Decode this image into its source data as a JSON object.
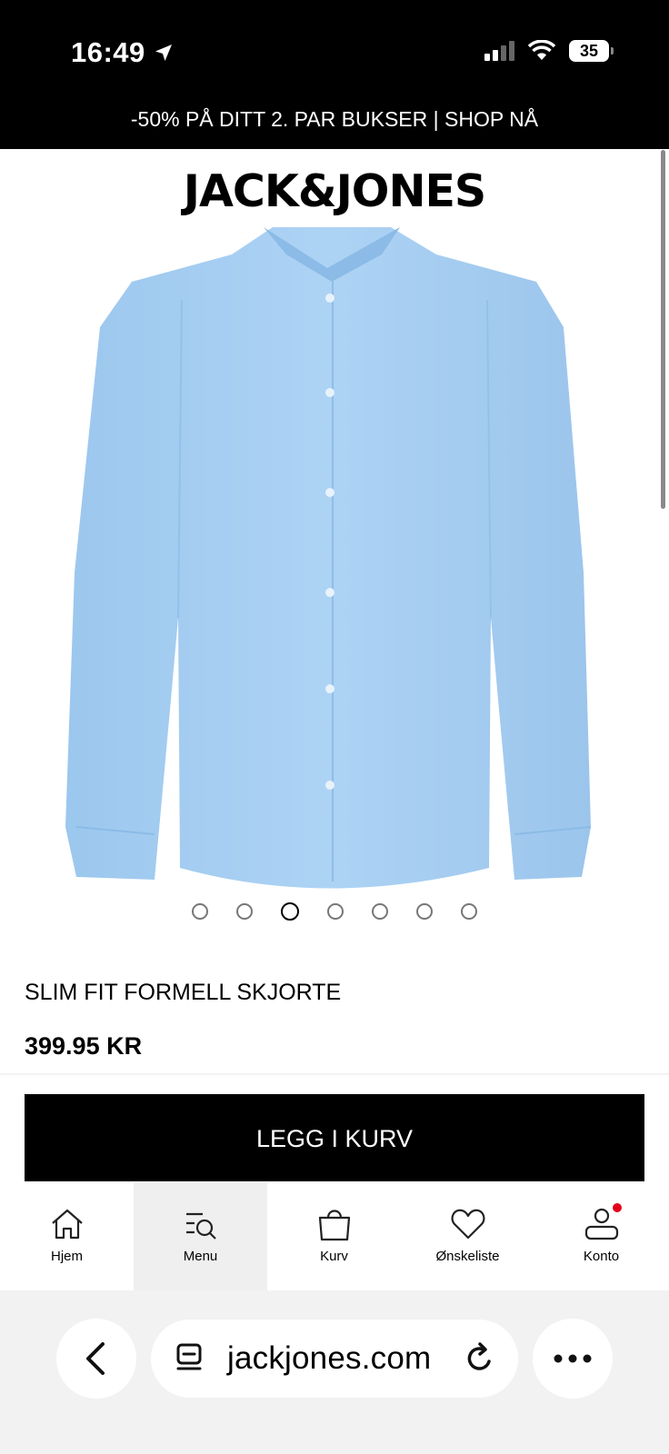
{
  "status_bar": {
    "time": "16:49",
    "battery": "35"
  },
  "promo": {
    "text": "-50% PÅ DITT 2. PAR BUKSER | SHOP NÅ"
  },
  "brand": {
    "logo": "JACK&JONES"
  },
  "product": {
    "image_icon": "light-blue-shirt",
    "gallery_count": 7,
    "gallery_active_index": 2,
    "title": "SLIM FIT FORMELL SKJORTE",
    "price": "399.95 KR",
    "add_to_cart_label": "LEGG I KURV"
  },
  "bottom_nav": {
    "items": [
      {
        "label": "Hjem",
        "icon": "home-icon"
      },
      {
        "label": "Menu",
        "icon": "search-menu-icon"
      },
      {
        "label": "Kurv",
        "icon": "bag-icon"
      },
      {
        "label": "Ønskeliste",
        "icon": "heart-icon"
      },
      {
        "label": "Konto",
        "icon": "account-icon"
      }
    ],
    "active_index": 1
  },
  "browser": {
    "url": "jackjones.com"
  },
  "colors": {
    "accent": "#000000",
    "notification": "#e3001b",
    "shirt": "#a9d0f3"
  }
}
